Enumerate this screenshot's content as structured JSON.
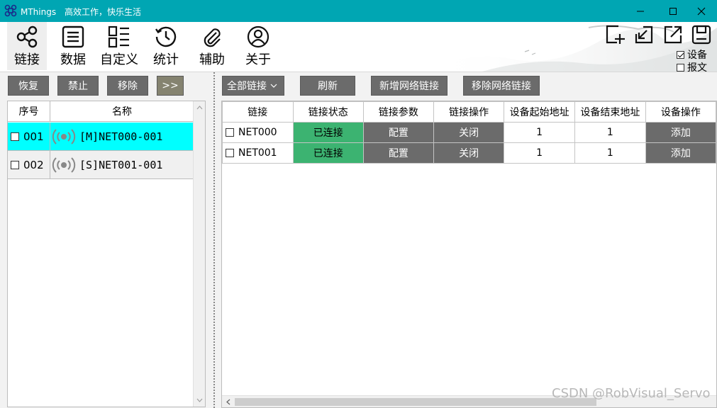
{
  "window": {
    "app_name": "MThings",
    "slogan": "高效工作，快乐生活"
  },
  "toolbar": {
    "items": [
      {
        "label": "链接",
        "icon": "share-icon"
      },
      {
        "label": "数据",
        "icon": "list-icon"
      },
      {
        "label": "自定义",
        "icon": "grid-list-icon"
      },
      {
        "label": "统计",
        "icon": "history-icon"
      },
      {
        "label": "辅助",
        "icon": "paperclip-icon"
      },
      {
        "label": "关于",
        "icon": "user-circle-icon"
      }
    ],
    "options": {
      "device": {
        "label": "设备",
        "checked": true
      },
      "message": {
        "label": "报文",
        "checked": false
      }
    }
  },
  "left": {
    "buttons": {
      "restore": "恢复",
      "disable": "禁止",
      "remove": "移除",
      "expand": ">>"
    },
    "columns": {
      "index": "序号",
      "name": "名称"
    },
    "rows": [
      {
        "index": "001",
        "name": "[M]NET000-001",
        "selected": true
      },
      {
        "index": "002",
        "name": "[S]NET001-001",
        "selected": false
      }
    ]
  },
  "right": {
    "buttons": {
      "all_links": "全部链接",
      "refresh": "刷新",
      "add_net": "新增网络链接",
      "remove_net": "移除网络链接"
    },
    "columns": [
      "链接",
      "链接状态",
      "链接参数",
      "链接操作",
      "设备起始地址",
      "设备结束地址",
      "设备操作"
    ],
    "rows": [
      {
        "link": "NET000",
        "status": "已连接",
        "param": "配置",
        "op": "关闭",
        "start": "1",
        "end": "1",
        "dev_op": "添加"
      },
      {
        "link": "NET001",
        "status": "已连接",
        "param": "配置",
        "op": "关闭",
        "start": "1",
        "end": "1",
        "dev_op": "添加"
      }
    ]
  },
  "watermark": "CSDN @RobVisual_Servo",
  "colors": {
    "titlebar": "#00a6b3",
    "selected_row": "#00ffff",
    "connected": "#3cb371",
    "button": "#6b6b6b"
  }
}
